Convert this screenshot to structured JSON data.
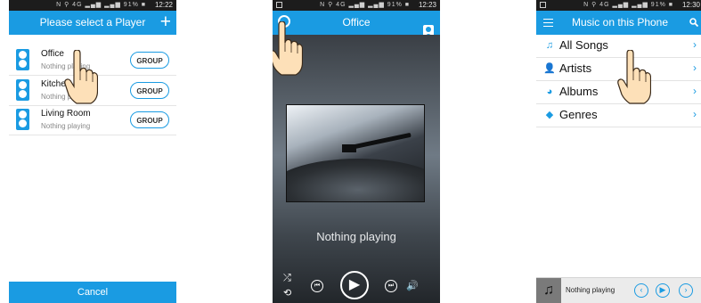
{
  "colors": {
    "accent": "#1a9be2",
    "status_bar": "#1c1c1c",
    "player_bg": "#2a2d31"
  },
  "screens": [
    {
      "status": {
        "icons": "N ⚲ 4G ▂▄▆ ▂▄▆ 91% ■",
        "time": "12:22"
      },
      "appbar": {
        "title": "Please select a Player",
        "action_icon": "plus-icon"
      },
      "players": [
        {
          "name": "Office",
          "sub": "Nothing playing",
          "button": "GROUP"
        },
        {
          "name": "Kitchen",
          "sub": "Nothing playing",
          "button": "GROUP"
        },
        {
          "name": "Living Room",
          "sub": "Nothing playing",
          "button": "GROUP"
        }
      ],
      "cancel": "Cancel"
    },
    {
      "status": {
        "icons": "N ⚲ 4G ▂▄▆ ▂▄▆ 91% ■",
        "time": "12:23"
      },
      "appbar": {
        "title": "Office"
      },
      "now_playing": "Nothing playing",
      "controls": [
        "shuffle-icon",
        "repeat-icon",
        "previous-icon",
        "play-icon",
        "next-icon",
        "volume-icon"
      ]
    },
    {
      "status": {
        "icons": "N ⚲ 4G ▂▄▆ ▂▄▆ 91% ■",
        "time": "12:30"
      },
      "appbar": {
        "title": "Music on this Phone",
        "left_icon": "menu-icon",
        "right_icon": "search-icon"
      },
      "menu": [
        {
          "label": "All Songs",
          "icon": "note-icon"
        },
        {
          "label": "Artists",
          "icon": "person-icon"
        },
        {
          "label": "Albums",
          "icon": "disc-icon"
        },
        {
          "label": "Genres",
          "icon": "tag-icon"
        }
      ],
      "mini_player": {
        "text": "Nothing playing"
      }
    }
  ]
}
